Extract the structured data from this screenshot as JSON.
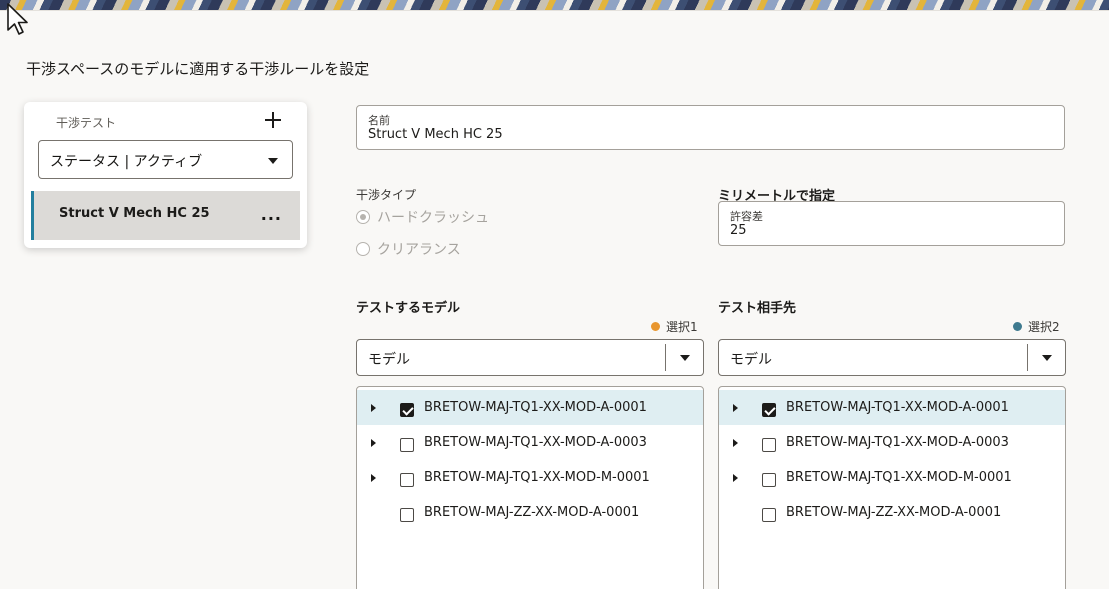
{
  "page_heading": "干渉スペースのモデルに適用する干渉ルールを設定",
  "clash_tests_panel": {
    "title": "干渉テスト",
    "status_filter": "ステータス | アクティブ",
    "items": [
      {
        "label": "Struct V Mech HC 25",
        "more": "..."
      }
    ]
  },
  "name_field": {
    "label": "名前",
    "value": "Struct V Mech HC 25"
  },
  "clash_type": {
    "label": "干渉タイプ",
    "options": [
      {
        "label": "ハードクラッシュ",
        "checked": true
      },
      {
        "label": "クリアランス",
        "checked": false
      }
    ]
  },
  "tolerance": {
    "section_label": "ミリメートルで指定",
    "label": "許容差",
    "value": "25"
  },
  "models_to_test": {
    "title": "テストするモデル",
    "selection_label": "選択1",
    "selection_color": "#e8962e",
    "select_value": "モデル",
    "rows": [
      {
        "label": "BRETOW-MAJ-TQ1-XX-MOD-A-0001",
        "checked": true,
        "expandable": true
      },
      {
        "label": "BRETOW-MAJ-TQ1-XX-MOD-A-0003",
        "checked": false,
        "expandable": true
      },
      {
        "label": "BRETOW-MAJ-TQ1-XX-MOD-M-0001",
        "checked": false,
        "expandable": true
      },
      {
        "label": "BRETOW-MAJ-ZZ-XX-MOD-A-0001",
        "checked": false,
        "expandable": false
      }
    ]
  },
  "test_against": {
    "title": "テスト相手先",
    "selection_label": "選択2",
    "selection_color": "#3f7a8f",
    "select_value": "モデル",
    "rows": [
      {
        "label": "BRETOW-MAJ-TQ1-XX-MOD-A-0001",
        "checked": true,
        "expandable": true
      },
      {
        "label": "BRETOW-MAJ-TQ1-XX-MOD-A-0003",
        "checked": false,
        "expandable": true
      },
      {
        "label": "BRETOW-MAJ-TQ1-XX-MOD-M-0001",
        "checked": false,
        "expandable": true
      },
      {
        "label": "BRETOW-MAJ-ZZ-XX-MOD-A-0001",
        "checked": false,
        "expandable": false
      }
    ]
  }
}
